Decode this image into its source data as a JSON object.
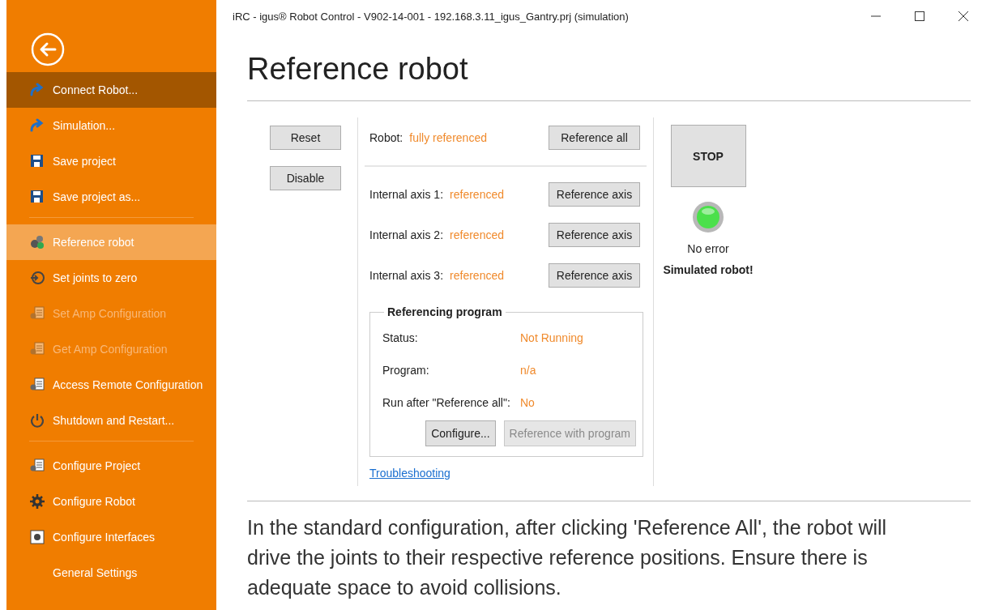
{
  "window": {
    "title": "iRC - igus® Robot Control - V902-14-001 - 192.168.3.11_igus_Gantry.prj (simulation)"
  },
  "sidebar": {
    "groups": [
      [
        {
          "label": "Connect Robot...",
          "hovered": true,
          "selected": false,
          "disabled": false
        },
        {
          "label": "Simulation...",
          "hovered": false,
          "selected": false,
          "disabled": false
        },
        {
          "label": "Save project",
          "hovered": false,
          "selected": false,
          "disabled": false
        },
        {
          "label": "Save project as...",
          "hovered": false,
          "selected": false,
          "disabled": false
        }
      ],
      [
        {
          "label": "Reference robot",
          "hovered": false,
          "selected": true,
          "disabled": false
        },
        {
          "label": "Set joints to zero",
          "hovered": false,
          "selected": false,
          "disabled": false
        },
        {
          "label": "Set Amp Configuration",
          "hovered": false,
          "selected": false,
          "disabled": true
        },
        {
          "label": "Get Amp Configuration",
          "hovered": false,
          "selected": false,
          "disabled": true
        },
        {
          "label": "Access Remote Configuration",
          "hovered": false,
          "selected": false,
          "disabled": false
        },
        {
          "label": "Shutdown and Restart...",
          "hovered": false,
          "selected": false,
          "disabled": false
        }
      ],
      [
        {
          "label": "Configure Project",
          "hovered": false,
          "selected": false,
          "disabled": false
        },
        {
          "label": "Configure Robot",
          "hovered": false,
          "selected": false,
          "disabled": false
        },
        {
          "label": "Configure Interfaces",
          "hovered": false,
          "selected": false,
          "disabled": false
        },
        {
          "label": "General Settings",
          "hovered": false,
          "selected": false,
          "disabled": false
        }
      ]
    ]
  },
  "heading": "Reference robot",
  "side_buttons": [
    "Reset",
    "Disable"
  ],
  "robot": {
    "label": "Robot:",
    "value": "fully referenced",
    "button": "Reference all"
  },
  "axes": [
    {
      "label": "Internal axis 1:",
      "value": "referenced",
      "button": "Reference axis"
    },
    {
      "label": "Internal axis 2:",
      "value": "referenced",
      "button": "Reference axis"
    },
    {
      "label": "Internal axis 3:",
      "value": "referenced",
      "button": "Reference axis"
    }
  ],
  "referencing_program": {
    "title": "Referencing program",
    "rows": [
      {
        "label": "Status:",
        "value": "Not Running"
      },
      {
        "label": "Program:",
        "value": "n/a"
      },
      {
        "label": "Run after \"Reference all\":",
        "value": "No"
      }
    ],
    "buttons": [
      {
        "label": "Configure...",
        "disabled": false
      },
      {
        "label": "Reference with program",
        "disabled": true
      }
    ]
  },
  "link": "Troubleshooting",
  "stop_button": "STOP",
  "status": {
    "error": false,
    "text": "No error",
    "note": "Simulated robot!"
  },
  "description": "In the standard configuration, after clicking 'Reference All', the robot will drive the joints to their respective reference positions. Ensure there is adequate space to avoid collisions."
}
